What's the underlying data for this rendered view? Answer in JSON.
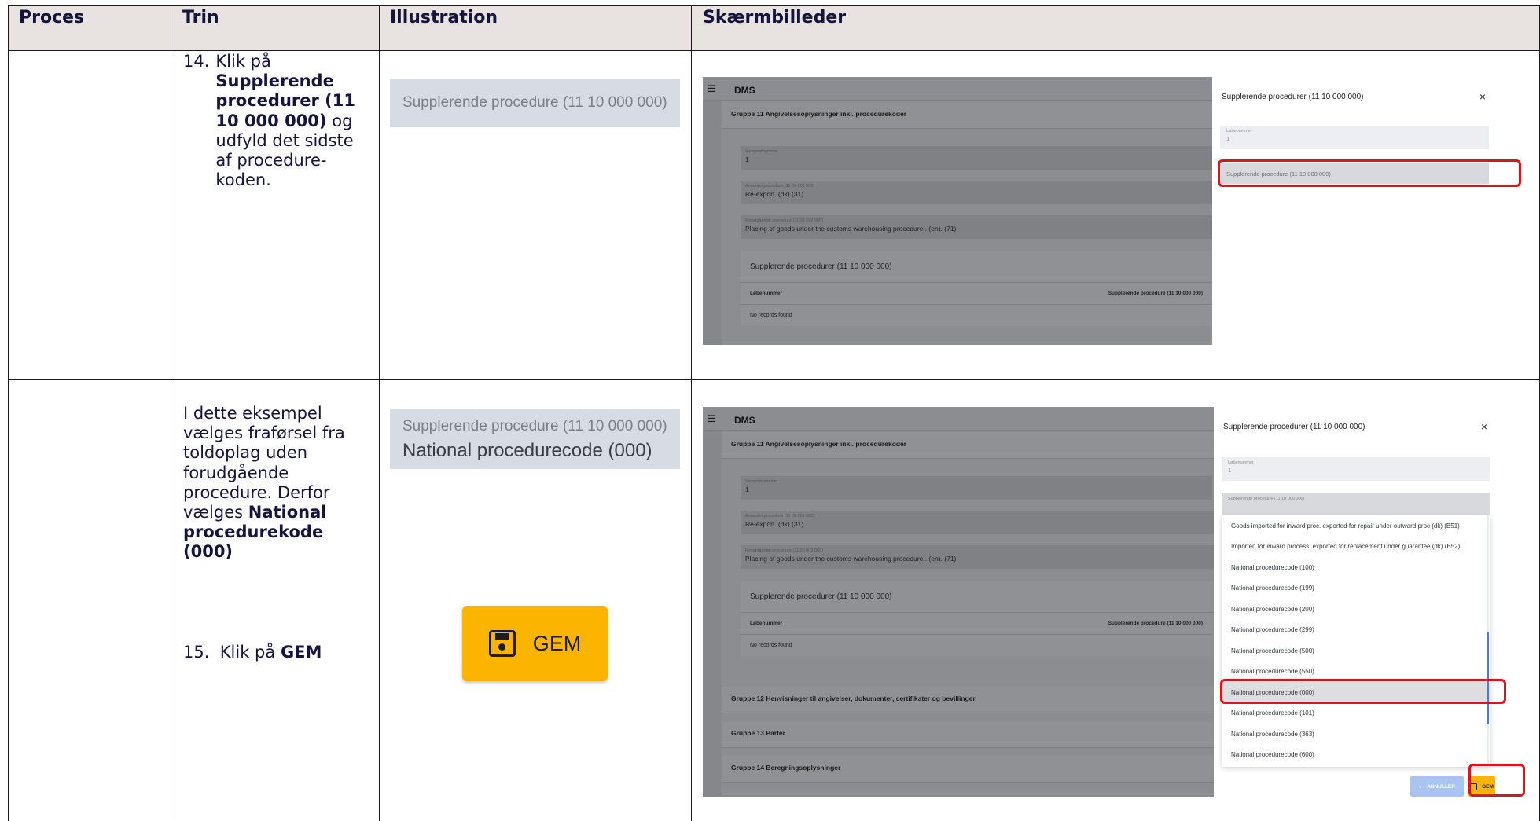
{
  "table": {
    "headers": [
      "Proces",
      "Trin",
      "Illustration",
      "Skærmbilleder"
    ]
  },
  "row1": {
    "step_number": "14.",
    "step_text_prefix": "Klik på",
    "step_bold": "Supplerende procedurer (11 10 000 000)",
    "step_text_suffix": "og udfyld det sidste af procedure-koden.",
    "illustration_text": "Supplerende procedure (11 10 000 000)"
  },
  "row2": {
    "text_prefix": "I dette eksempel vælges fraførsel fra toldoplag uden forudgående procedure. Derfor vælges",
    "text_bold": "National procedurekode (000)",
    "step_number": "15.",
    "step_text_prefix": "Klik på",
    "step_bold": "GEM",
    "illustration_label": "Supplerende procedure (11 10 000 000)",
    "illustration_value": "National procedurecode (000)",
    "gem_button_label": "GEM"
  },
  "screenshot": {
    "app_name": "DMS",
    "group11_title": "Gruppe 11 Angivelsesoplysninger inkl. procedurekoder",
    "varepost_label": "Varepostnummer",
    "varepost_value": "1",
    "anmodet_label": "Anmodet procedure (11 09 001 000)",
    "anmodet_value": "Re-export. (dk) (31)",
    "forudgaaende_label": "Forudgående procedure (11 09 002 000)",
    "forudgaaende_value": "Placing of goods under the customs warehousing procedure.. (en). (71)",
    "sub_title": "Supplerende procedurer (11 10 000 000)",
    "col_loebenummer": "Løbenummer",
    "col_supplerende": "Supplerende procedure (11 10 000 000)",
    "no_records": "No records found",
    "group12_title": "Gruppe 12 Henvisninger til angivelser, dokumenter, certifikater og bevillinger",
    "group13_title": "Gruppe 13 Parter",
    "group14_title": "Gruppe 14 Beregningsoplysninger",
    "panel_title": "Supplerende procedurer (11 10 000 000)",
    "close_icon_text": "×",
    "panel_loebenummer_label": "Løbenummer",
    "panel_loebenummer_value": "1",
    "panel_supplerende_label": "Supplerende procedure (11 10 000 000)",
    "options": [
      "Goods imported for inward proc. exported for repair under outward proc (dk) (B51)",
      "Imported for inward process. exported for replacement under guarantee (dk) (B52)",
      "National procedurecode (100)",
      "National procedurecode (199)",
      "National procedurecode (200)",
      "National procedurecode (299)",
      "National procedurecode (500)",
      "National procedurecode (550)",
      "National procedurecode (000)",
      "National procedurecode (101)",
      "National procedurecode (363)",
      "National procedurecode (600)"
    ],
    "selected_option_index": 8,
    "cancel_label": "ANNULLER",
    "save_label": "GEM"
  },
  "colors": {
    "header_bg": "#e8e3e0",
    "highlight_red": "#e0121a",
    "gem_yellow": "#fbb400"
  }
}
